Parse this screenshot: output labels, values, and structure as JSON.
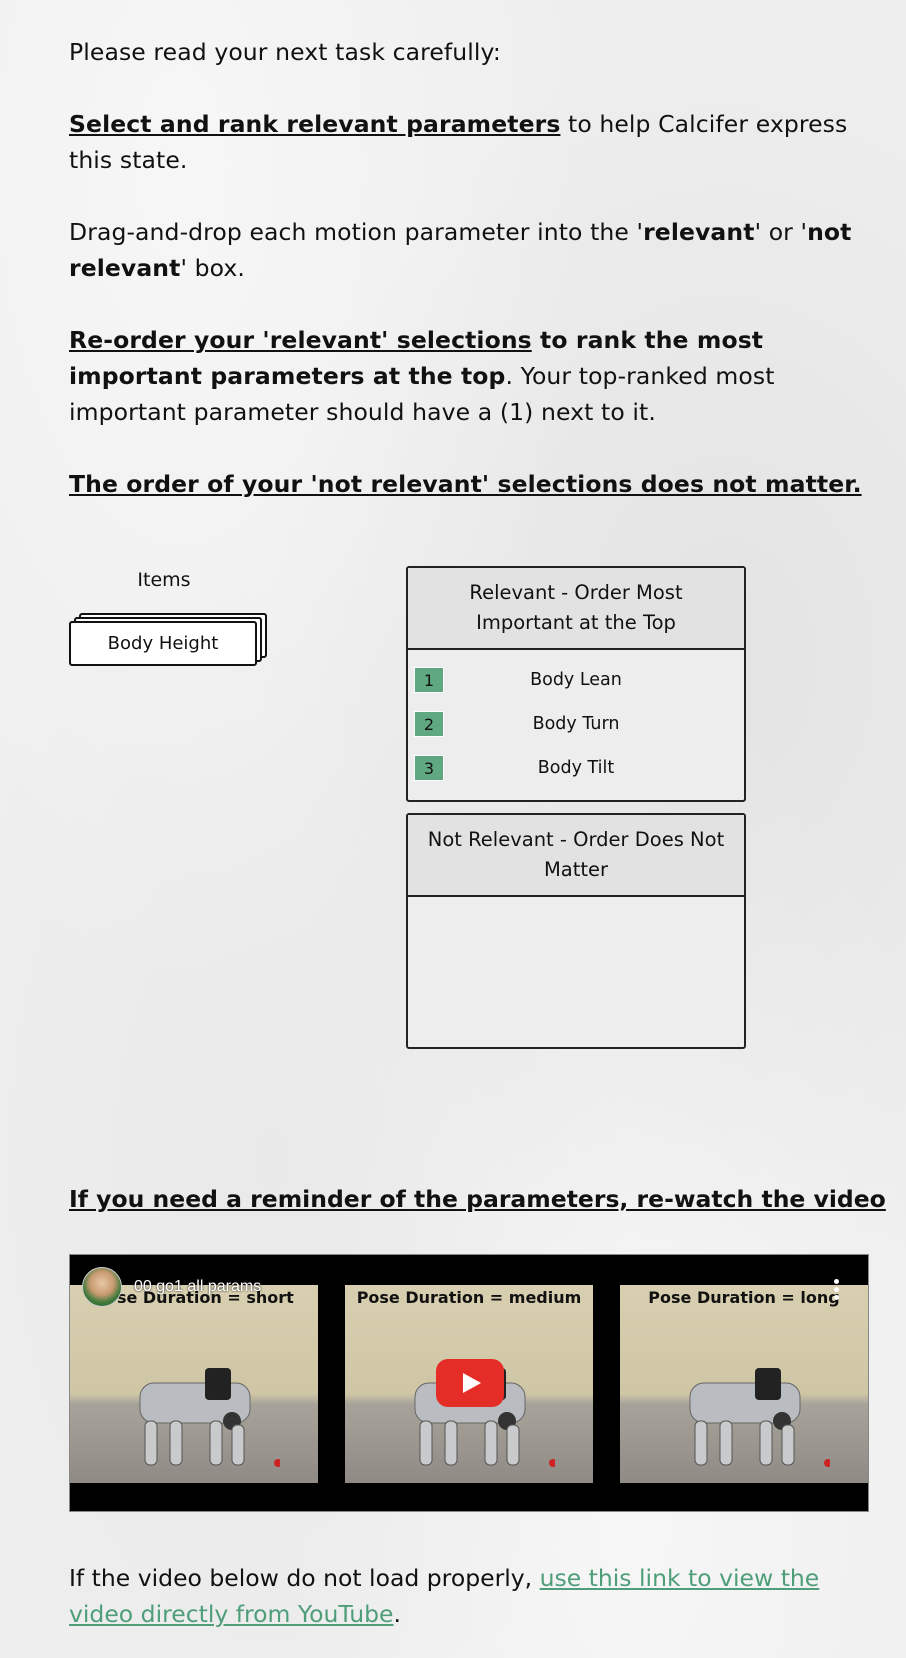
{
  "instructions": {
    "intro": "Please read your next task carefully:",
    "task_bold": "Select and rank relevant parameters",
    "task_rest": " to help Calcifer express this state.",
    "drag_pre": "Drag-and-drop each motion parameter into the '",
    "drag_relevant": "relevant",
    "drag_mid": "' or '",
    "drag_not_relevant": "not relevant",
    "drag_post": "' box.",
    "reorder_ul": "Re-order your 'relevant' selections",
    "reorder_bold": " to rank the most important parameters at the top",
    "reorder_rest": ". Your top-ranked most important parameter should have a (1) next to it.",
    "not_relevant_note": "The order of your 'not relevant' selections does not matter."
  },
  "items_column": {
    "title": "Items",
    "cards": [
      "Body Height"
    ]
  },
  "relevant_box": {
    "title": "Relevant - Order Most Important at the Top",
    "items": [
      {
        "rank": "1",
        "label": "Body Lean"
      },
      {
        "rank": "2",
        "label": "Body Turn"
      },
      {
        "rank": "3",
        "label": "Body Tilt"
      }
    ]
  },
  "not_relevant_box": {
    "title": "Not Relevant - Order Does Not Matter",
    "items": []
  },
  "video_section": {
    "heading": "If you need a reminder of the parameters, re-watch the video",
    "video_title": "00 go1 all params",
    "frames": [
      {
        "caption": "Pose Duration = short"
      },
      {
        "caption": "Pose Duration = medium"
      },
      {
        "caption": "Pose Duration = long"
      }
    ]
  },
  "footer": {
    "pre": "If the video below do not load properly, ",
    "link_text": "use this link to view the video directly from YouTube",
    "post": "."
  },
  "colors": {
    "rank_badge": "#5fa882",
    "link": "#4e9e79",
    "play_button": "#e52d27"
  }
}
